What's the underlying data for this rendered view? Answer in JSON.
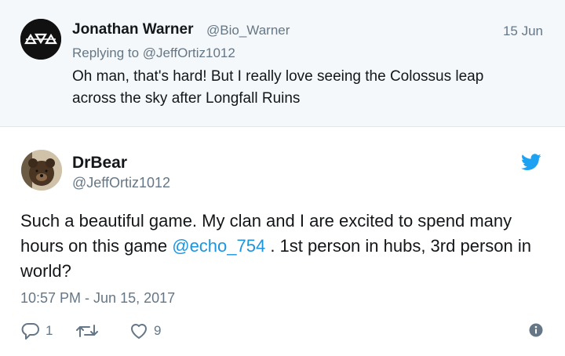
{
  "reply": {
    "name": "Jonathan Warner",
    "handle": "@Bio_Warner",
    "date": "15 Jun",
    "replying_to": "Replying to @JeffOrtiz1012",
    "text_line1": "Oh man, that's hard! But I really love seeing the Colossus leap",
    "text_line2": "across the sky after Longfall Ruins"
  },
  "tweet": {
    "name": "DrBear",
    "handle": "@JeffOrtiz1012",
    "text_before": "Such a beautiful game. My clan and I are excited to spend many hours on this game ",
    "mention": "@echo_754",
    "text_after": " . 1st person in hubs, 3rd person in world?",
    "timestamp": "10:57 PM - Jun 15, 2017",
    "reply_count": "1",
    "retweet_count": "",
    "like_count": "9"
  },
  "colors": {
    "accent": "#1b95e0",
    "muted": "#657786",
    "reply_background": "#f5f8fa"
  },
  "icons": [
    "reply-icon",
    "retweet-icon",
    "heart-icon",
    "info-icon",
    "twitter-bird-icon"
  ]
}
